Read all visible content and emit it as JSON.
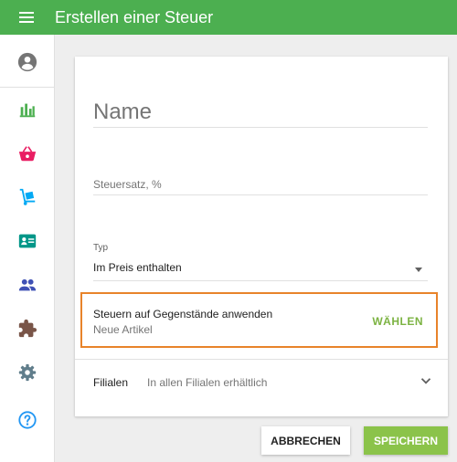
{
  "header": {
    "title": "Erstellen einer Steuer"
  },
  "sidebar": {
    "items": [
      {
        "icon": "account-circle-icon",
        "color": "#757575"
      },
      {
        "icon": "bar-chart-icon",
        "color": "#4caf50"
      },
      {
        "icon": "shopping-basket-icon",
        "color": "#e91e63"
      },
      {
        "icon": "cart-dolly-icon",
        "color": "#03a9f4"
      },
      {
        "icon": "id-card-icon",
        "color": "#009688"
      },
      {
        "icon": "people-icon",
        "color": "#3f51b5"
      },
      {
        "icon": "puzzle-icon",
        "color": "#795548"
      },
      {
        "icon": "gear-icon",
        "color": "#607d8b"
      },
      {
        "icon": "help-icon",
        "color": "#2196f3"
      }
    ]
  },
  "form": {
    "name_placeholder": "Name",
    "rate_placeholder": "Steuersatz, %",
    "type_label": "Typ",
    "type_value": "Im Preis enthalten",
    "apply_title": "Steuern auf Gegenstände anwenden",
    "apply_subtitle": "Neue Artikel",
    "apply_button": "WÄHLEN",
    "stores_label": "Filialen",
    "stores_value": "In allen Filialen erhältlich"
  },
  "actions": {
    "cancel": "ABBRECHEN",
    "save": "SPEICHERN"
  },
  "colors": {
    "appbar": "#4caf50",
    "highlight_border": "#e8832a",
    "accent": "#7cb342",
    "save_button": "#8bc34a"
  }
}
